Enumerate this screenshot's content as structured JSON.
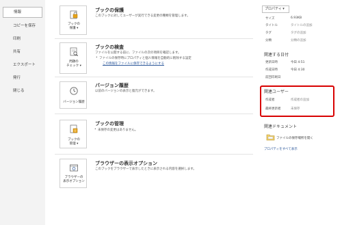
{
  "nav": {
    "items": [
      "情報",
      "コピーを保存",
      "印刷",
      "共有",
      "エクスポート",
      "発行",
      "閉じる"
    ]
  },
  "protect": {
    "button_label": [
      "ブックの",
      "保護 ▾"
    ],
    "title": "ブックの保護",
    "desc": "このブックに対してユーザーが実行できる変更の種類を管理します。"
  },
  "inspect": {
    "button_label": [
      "問題の",
      "チェック ▾"
    ],
    "title": "ブックの検査",
    "desc": "ファイルを公開する前に、ファイルの次の項目を確認します。",
    "bullet": "ファイルの保存時にプロパティと個人情報を自動的に削除する設定",
    "link": "この情報をファイルに保存できるようにする"
  },
  "versions": {
    "button_label": [
      "バージョン履歴"
    ],
    "title": "バージョン履歴",
    "desc": "以前のバージョンの表示と復元ができます。"
  },
  "manage": {
    "button_label": [
      "ブックの",
      "管理 ▾"
    ],
    "title": "ブックの管理",
    "bullet": "未保存の変更はありません。"
  },
  "browser": {
    "button_label": [
      "ブラウザーの",
      "表示オプション"
    ],
    "title": "ブラウザーの表示オプション",
    "desc": "このブックをブラウザーで表示したときに表示される内容を選択します。"
  },
  "properties": {
    "dropdown": "プロパティ ▾",
    "rows": [
      {
        "label": "サイズ",
        "value": "6.93KB"
      },
      {
        "label": "タイトル",
        "value": "タイトルの追加"
      },
      {
        "label": "タグ",
        "value": "タグの追加"
      },
      {
        "label": "分類",
        "value": "分類の追加"
      }
    ]
  },
  "dates": {
    "heading": "関連する日付",
    "rows": [
      {
        "label": "更新日時",
        "value": "今日 4:51"
      },
      {
        "label": "作成日時",
        "value": "今日 4:30"
      },
      {
        "label": "前回印刷日",
        "value": ""
      }
    ]
  },
  "people": {
    "heading": "関連ユーザー",
    "rows": [
      {
        "label": "作成者",
        "value": "作成者の追加"
      },
      {
        "label": "最終更新者",
        "value": "未保存"
      }
    ]
  },
  "documents": {
    "heading": "関連ドキュメント",
    "link": "ファイルの保存場所を開く",
    "all_properties": "プロパティをすべて表示"
  },
  "colors": {
    "nav_bg": "#f3f3f3",
    "highlight": "#d80000",
    "link": "#2b579a",
    "icon_gold": "#e8a317"
  }
}
